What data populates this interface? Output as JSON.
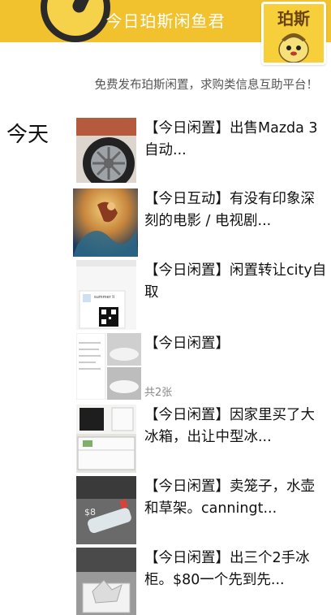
{
  "header": {
    "title": "今日珀斯闲鱼君",
    "logo_text": "珀斯"
  },
  "tagline": "免费发布珀斯闲置，求购类信息互助平台！",
  "section_label": "今天",
  "items": [
    {
      "title": "【今日闲置】出售Mazda 3 自动..."
    },
    {
      "title": "【今日互动】有没有印象深刻的电影 / 电视剧..."
    },
    {
      "title": "【今日闲置】闲置转让city自取"
    },
    {
      "title": "【今日闲置】",
      "count": "共2张"
    },
    {
      "title": "【今日闲置】因家里买了大冰箱，出让中型冰..."
    },
    {
      "title": "【今日闲置】卖笼子，水壶和草架。canningt..."
    },
    {
      "title": "【今日闲置】出三个2手冰柜。$80一个先到先..."
    }
  ],
  "thumbs": {
    "qr_name": "summer li",
    "price_tag": "$8"
  },
  "colors": {
    "header_bg": "#f2c12e",
    "logo_bg": "#f7cf3a"
  }
}
